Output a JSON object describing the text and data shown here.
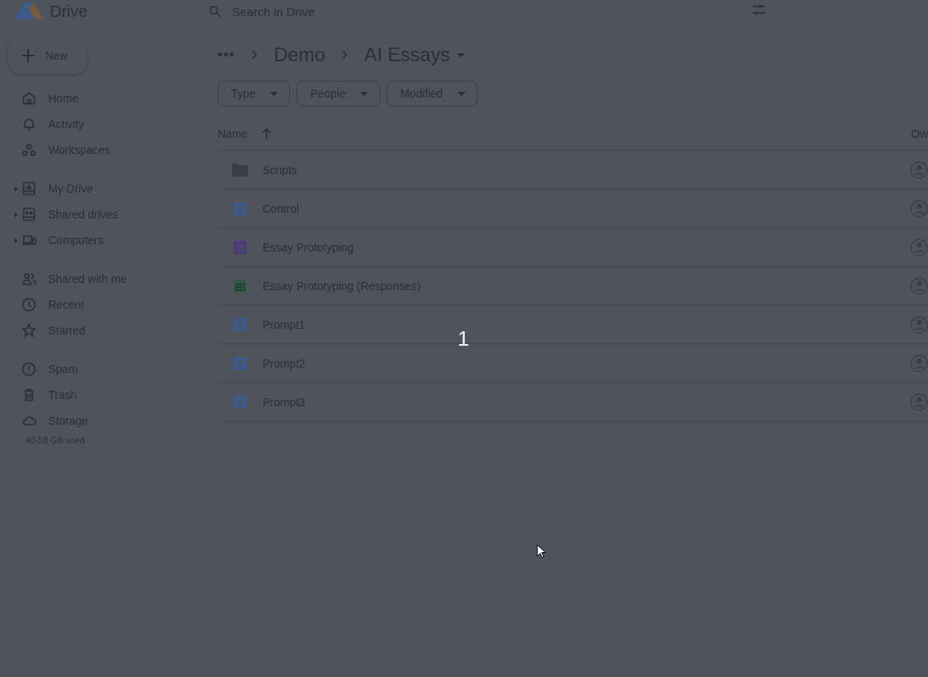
{
  "header": {
    "app_name": "Drive",
    "search": {
      "placeholder": "Search in Drive"
    }
  },
  "new_button": {
    "label": "New"
  },
  "sidebar": {
    "groups": [
      [
        {
          "label": "Home",
          "expandable": false
        },
        {
          "label": "Activity",
          "expandable": false
        },
        {
          "label": "Workspaces",
          "expandable": false
        }
      ],
      [
        {
          "label": "My Drive",
          "expandable": true
        },
        {
          "label": "Shared drives",
          "expandable": true
        },
        {
          "label": "Computers",
          "expandable": true
        }
      ],
      [
        {
          "label": "Shared with me",
          "expandable": false
        },
        {
          "label": "Recent",
          "expandable": false
        },
        {
          "label": "Starred",
          "expandable": false
        }
      ],
      [
        {
          "label": "Spam",
          "expandable": false
        },
        {
          "label": "Trash",
          "expandable": false
        },
        {
          "label": "Storage",
          "expandable": false
        }
      ]
    ],
    "storage_used": "40.58 GB used"
  },
  "breadcrumb_more": "•••",
  "breadcrumb": [
    {
      "label": "Demo"
    },
    {
      "label": "AI Essays"
    }
  ],
  "filters": [
    {
      "label": "Type"
    },
    {
      "label": "People"
    },
    {
      "label": "Modified"
    }
  ],
  "table": {
    "columns": [
      "Name",
      "Ow"
    ],
    "rows": [
      {
        "name": "Scripts",
        "kind": "folder"
      },
      {
        "name": "Control",
        "kind": "doc"
      },
      {
        "name": "Essay Prototyping",
        "kind": "form"
      },
      {
        "name": "Essay Prototyping (Responses)",
        "kind": "sheet"
      },
      {
        "name": "Prompt1",
        "kind": "doc"
      },
      {
        "name": "Prompt2",
        "kind": "doc"
      },
      {
        "name": "Prompt3",
        "kind": "doc"
      }
    ]
  },
  "countdown": "1"
}
